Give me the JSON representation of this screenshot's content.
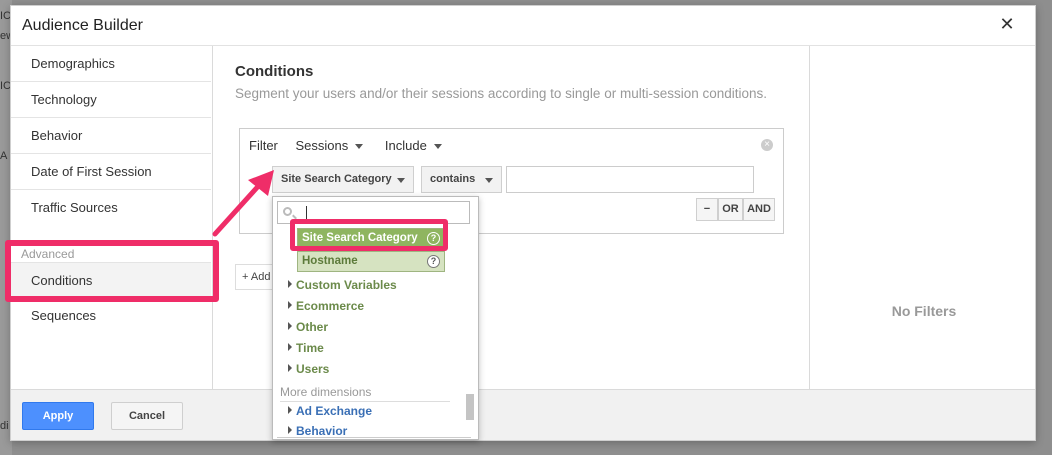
{
  "bg_fragments": [
    "IC",
    "ew",
    "IC",
    "A",
    "di"
  ],
  "dialog": {
    "title": "Audience Builder",
    "close_icon": "close-icon"
  },
  "sidebar": {
    "items": [
      {
        "label": "Demographics"
      },
      {
        "label": "Technology"
      },
      {
        "label": "Behavior"
      },
      {
        "label": "Date of First Session"
      },
      {
        "label": "Traffic Sources"
      }
    ],
    "section_label": "Advanced",
    "advanced_items": [
      {
        "label": "Conditions",
        "active": true
      },
      {
        "label": "Sequences"
      }
    ]
  },
  "main": {
    "title": "Conditions",
    "subtitle": "Segment your users and/or their sessions according to single or multi-session conditions.",
    "filter": {
      "label": "Filter",
      "scope": "Sessions",
      "mode": "Include",
      "dimension": "Site Search Category",
      "operator": "contains",
      "value": "",
      "minus_label": "−",
      "or_label": "OR",
      "and_label": "AND"
    },
    "add_label": "+ Add"
  },
  "right_panel": {
    "empty_text": "No Filters"
  },
  "footer": {
    "apply_label": "Apply",
    "cancel_label": "Cancel"
  },
  "dropdown": {
    "search_value": "",
    "options": [
      {
        "label": "Site Search Category",
        "selected": true,
        "help": "?"
      },
      {
        "label": "Hostname",
        "selected": false,
        "help": "?"
      }
    ],
    "groups": [
      "Custom Variables",
      "Ecommerce",
      "Other",
      "Time",
      "Users"
    ],
    "more_label": "More dimensions",
    "more_groups": [
      "Ad Exchange",
      "Behavior"
    ]
  },
  "colors": {
    "highlight": "#ef2d68",
    "apply_blue": "#4d90fe",
    "selected_green": "#8fb560",
    "option_green": "#d6e3c1"
  }
}
